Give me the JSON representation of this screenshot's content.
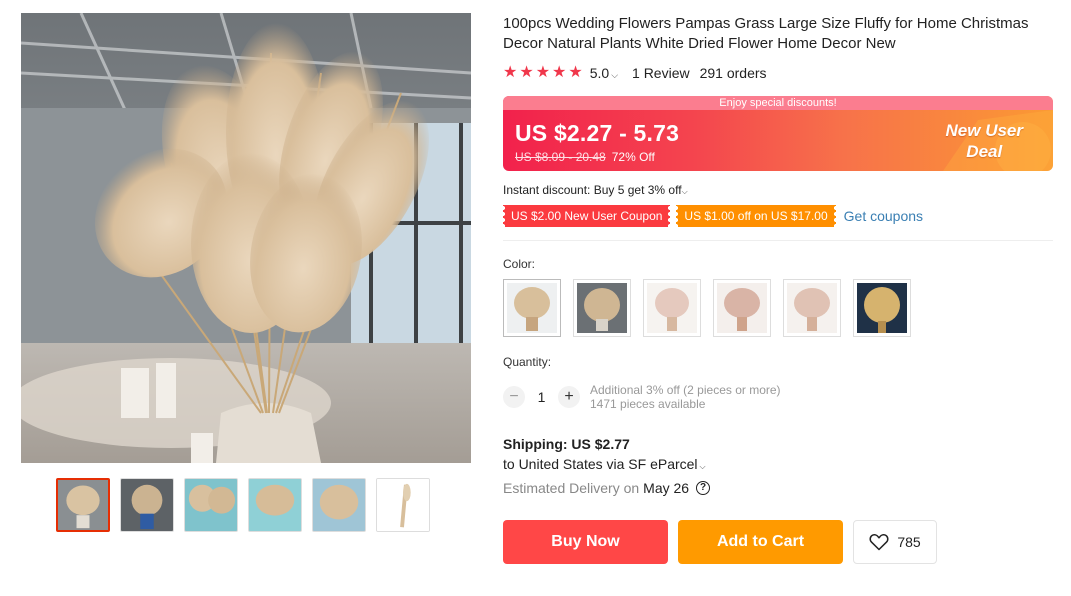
{
  "product": {
    "title": "100pcs Wedding Flowers Pampas Grass Large Size Fluffy for Home Christmas Decor Natural Plants White Dried Flower Home Decor New",
    "rating": "5.0",
    "reviews": "1 Review",
    "orders": "291 orders"
  },
  "price": {
    "banner_top": "Enjoy special discounts!",
    "range": "US $2.27 - 5.73",
    "original": "US $8.09 - 20.48",
    "discount": "72% Off",
    "new_user_line1": "New User",
    "new_user_line2": "Deal"
  },
  "promo": {
    "instant_discount": "Instant discount: Buy 5 get 3% off",
    "coupon_new_user": "US $2.00 New User Coupon",
    "coupon_off": "US $1.00 off on US $17.00",
    "get_coupons": "Get coupons"
  },
  "color": {
    "label": "Color:",
    "swatch_count": 6
  },
  "quantity": {
    "label": "Quantity:",
    "value": "1",
    "minus": "−",
    "plus": "+",
    "additional": "Additional 3% off (2 pieces or more)",
    "available": "1471 pieces available"
  },
  "shipping": {
    "title": "Shipping: US $2.77",
    "destination": "to United States via SF eParcel",
    "delivery_label": "Estimated Delivery on",
    "delivery_date": "May 26",
    "help": "?"
  },
  "actions": {
    "buy_now": "Buy Now",
    "add_to_cart": "Add to Cart",
    "wishlist_count": "785"
  },
  "colors": {
    "accent_red": "#ff4747",
    "accent_orange": "#ff9a00",
    "star": "#f0374b",
    "link": "#3a7fb3"
  }
}
